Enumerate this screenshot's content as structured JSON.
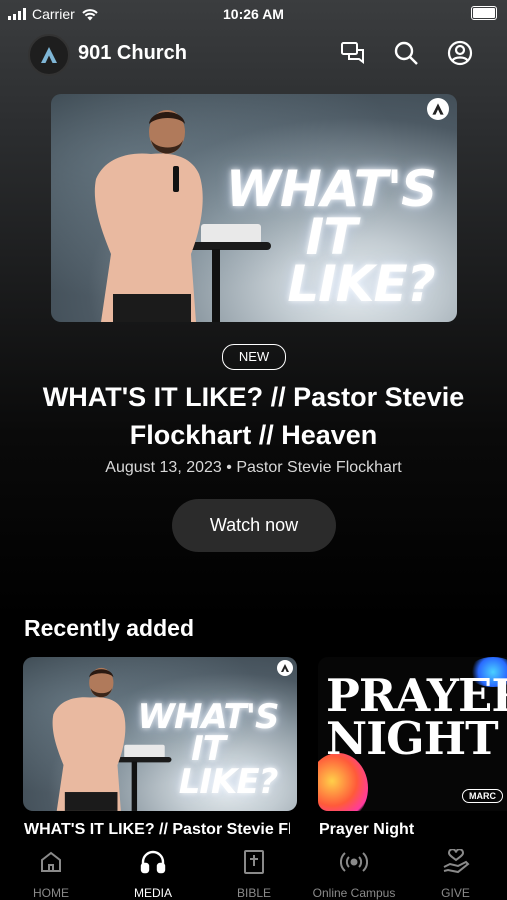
{
  "status_bar": {
    "carrier": "Carrier",
    "time": "10:26 AM"
  },
  "header": {
    "church_name": "901 Church",
    "icons": [
      "chat-icon",
      "search-icon",
      "profile-icon"
    ]
  },
  "hero": {
    "artwork_title_line1": "WHAT'S IT",
    "artwork_title_line2": "LIKE?",
    "badge": "NEW",
    "title": "WHAT'S IT LIKE? // Pastor Stevie Flockhart // Heaven",
    "date": "August 13, 2023",
    "separator": "•",
    "speaker": "Pastor Stevie Flockhart",
    "watch_label": "Watch now"
  },
  "recent": {
    "heading": "Recently added",
    "items": [
      {
        "title": "WHAT'S IT LIKE? // Pastor Stevie Flockhart",
        "art_line1": "WHAT'S IT",
        "art_line2": "LIKE?"
      },
      {
        "title": "Prayer Night",
        "art_line1": "PRAYER",
        "art_line2": "NIGHT",
        "art_tag": "MARC"
      }
    ]
  },
  "tabs": [
    {
      "label": "HOME",
      "icon": "home-icon",
      "active": false
    },
    {
      "label": "MEDIA",
      "icon": "headphones-icon",
      "active": true
    },
    {
      "label": "BIBLE",
      "icon": "bible-icon",
      "active": false
    },
    {
      "label": "Online Campus",
      "icon": "broadcast-icon",
      "active": false
    },
    {
      "label": "GIVE",
      "icon": "give-icon",
      "active": false
    }
  ],
  "colors": {
    "background": "#000000",
    "button": "#2b2b2b",
    "inactive_tab": "#8a8a8a"
  }
}
